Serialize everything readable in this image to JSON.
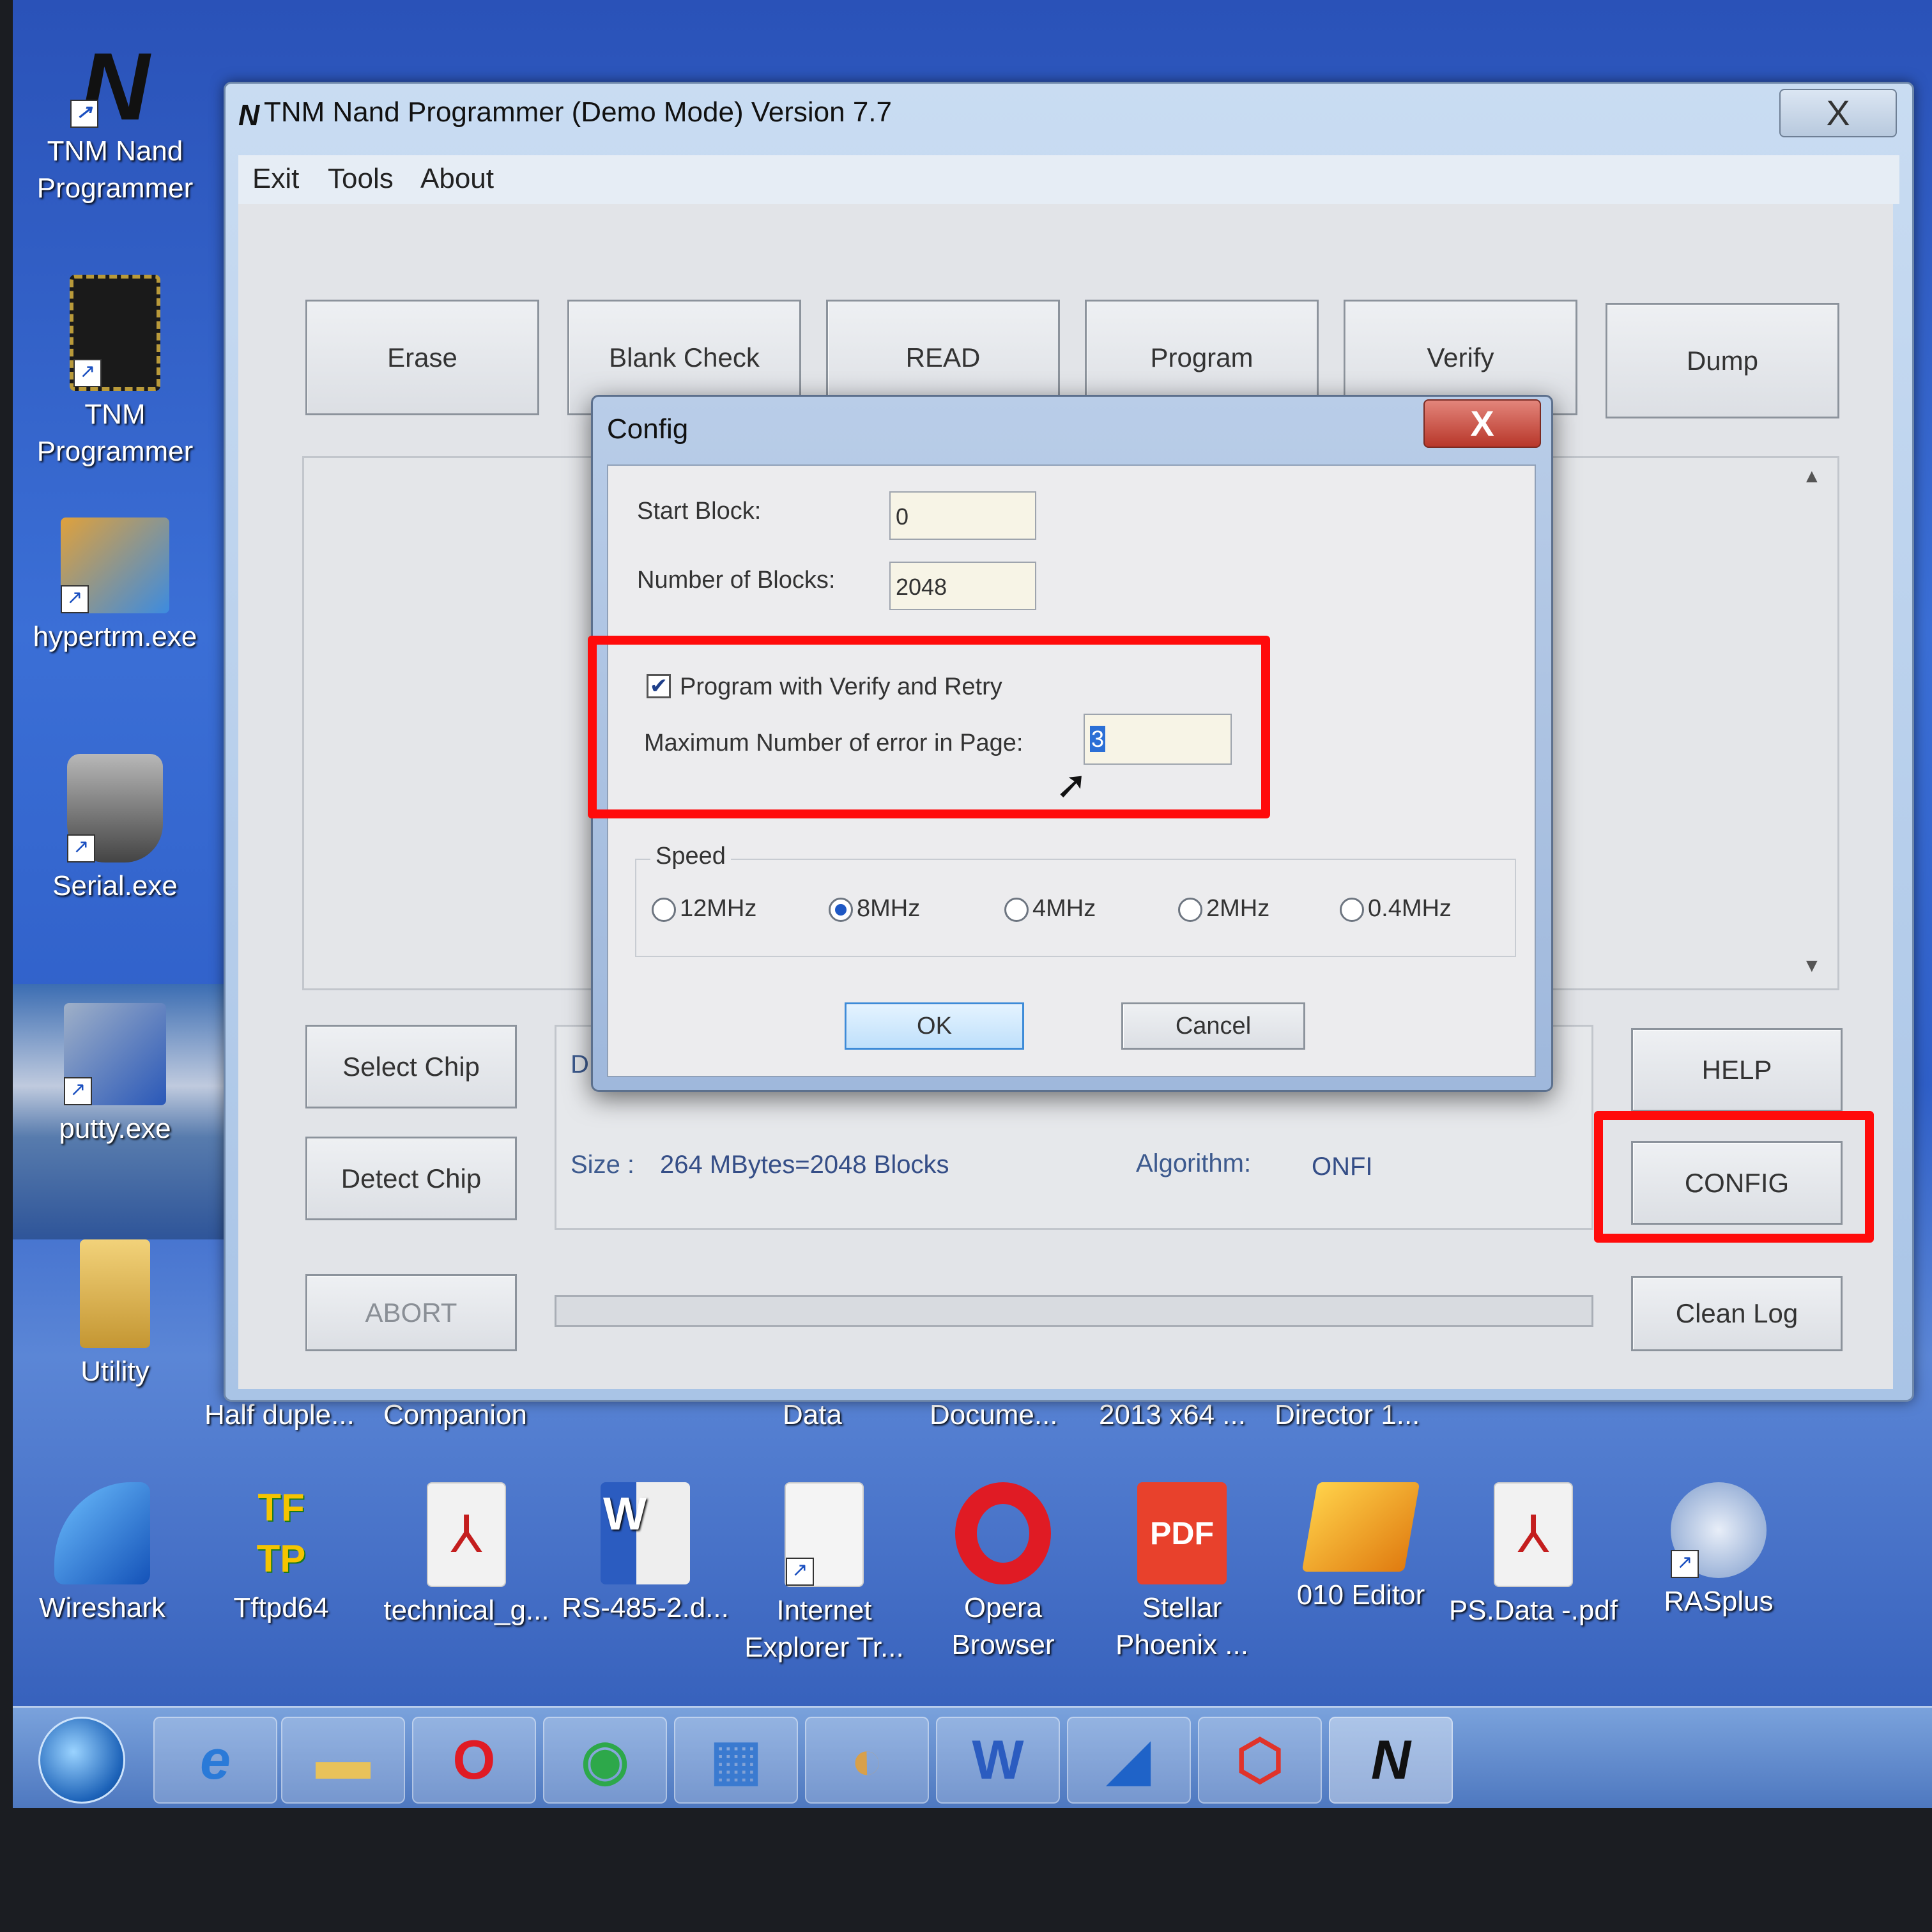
{
  "desktop": {
    "left_icons": [
      {
        "label": "TNM Nand\nProgrammer"
      },
      {
        "label": "TNM\nProgrammer"
      },
      {
        "label": "hypertrm.exe"
      },
      {
        "label": "Serial.exe"
      },
      {
        "label": "putty.exe"
      },
      {
        "label": "Utility"
      }
    ],
    "label_strip": [
      "Half duple...",
      "Companion",
      "Data",
      "Docume...",
      "2013 x64 ...",
      "Director 1..."
    ],
    "bottom_icons": [
      {
        "label": "Wireshark",
        "icon": "wireshark-icon"
      },
      {
        "label": "Tftpd64",
        "icon": "tftp-icon"
      },
      {
        "label": "technical_g...",
        "icon": "pdf-doc-icon"
      },
      {
        "label": "RS-485-2.d...",
        "icon": "word-doc-icon"
      },
      {
        "label": "Internet\nExplorer Tr...",
        "icon": "blank-doc-icon"
      },
      {
        "label": "Opera\nBrowser",
        "icon": "opera-icon"
      },
      {
        "label": "Stellar\nPhoenix ...",
        "icon": "pdf-tool-icon"
      },
      {
        "label": "010 Editor",
        "icon": "hex-editor-icon"
      },
      {
        "label": "PS.Data -.pdf",
        "icon": "pdf-doc-icon"
      },
      {
        "label": "RASplus",
        "icon": "network-icon"
      }
    ]
  },
  "app": {
    "title": "TNM  Nand Programmer  (Demo Mode)   Version 7.7",
    "close_glyph": "X",
    "menu": [
      "Exit",
      "Tools",
      "About"
    ],
    "top_buttons": [
      "Erase",
      "Blank Check",
      "READ",
      "Program",
      "Verify",
      "Dump"
    ],
    "left_buttons": {
      "select_chip": "Select Chip",
      "detect_chip": "Detect Chip",
      "abort": "ABORT"
    },
    "right_buttons": {
      "help": "HELP",
      "config": "CONFIG",
      "clean_log": "Clean Log"
    },
    "info": {
      "size_label": "Size :",
      "size_value": "264 MBytes=2048 Blocks",
      "algorithm_label": "Algorithm:",
      "algorithm_value": "ONFI",
      "hidden_label": "D"
    }
  },
  "config": {
    "title": "Config",
    "close_glyph": "X",
    "start_block_label": "Start Block:",
    "start_block_value": "0",
    "num_blocks_label": "Number of Blocks:",
    "num_blocks_value": "2048",
    "verify_retry_label": "Program with Verify and Retry",
    "verify_retry_checked": true,
    "max_errors_label": "Maximum Number of error in Page:",
    "max_errors_value": "3",
    "speed_label": "Speed",
    "speed_options": [
      "12MHz",
      "8MHz",
      "4MHz",
      "2MHz",
      "0.4MHz"
    ],
    "speed_selected": "8MHz",
    "ok_label": "OK",
    "cancel_label": "Cancel"
  },
  "colors": {
    "highlight": "#ff0b0b",
    "info_text": "#354e87"
  },
  "taskbar": {
    "items": [
      "internet-explorer-icon",
      "file-explorer-icon",
      "opera-icon",
      "chrome-icon",
      "control-panel-icon",
      "paint-icon",
      "word-icon",
      "wireshark-icon",
      "stellar-icon",
      "tnm-nand-icon"
    ]
  }
}
